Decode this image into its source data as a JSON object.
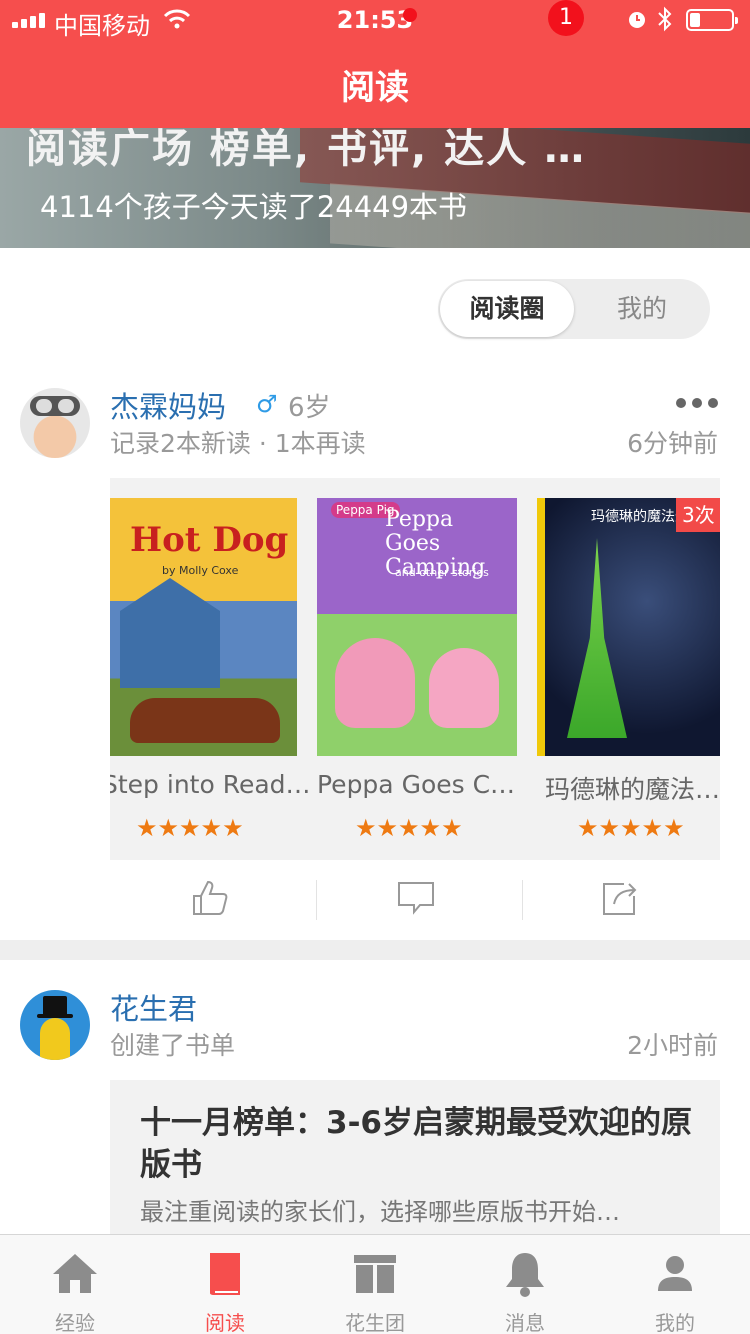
{
  "status_bar": {
    "carrier": "中国移动",
    "time": "21:53"
  },
  "nav": {
    "title": "阅读"
  },
  "banner": {
    "headline": "阅读广场 榜单, 书评, 达人 …",
    "subtitle": "4114个孩子今天读了24449本书"
  },
  "segmented": {
    "active": "阅读圈",
    "inactive": "我的"
  },
  "post1": {
    "user": "杰霖妈妈",
    "gender_symbol": "♂",
    "age": "6岁",
    "summary": "记录2本新读 · 1本再读",
    "time": "6分钟前",
    "books": [
      {
        "title": "Step into Read…",
        "cover_title": "Hot Dog",
        "cover_byline": "by Molly Coxe",
        "stars": "★★★★★",
        "rating": 5
      },
      {
        "title": "Peppa  Goes C…",
        "cover_title": "Peppa Goes Camping",
        "cover_subtitle": "and other stories",
        "cover_logo": "Peppa Pig",
        "stars": "★★★★★",
        "rating": 5
      },
      {
        "title": "玛德琳的魔法…",
        "cover_title": "玛德琳的魔法圣",
        "badge": "3次",
        "stars": "★★★★★",
        "rating": 5
      }
    ]
  },
  "post2": {
    "user": "花生君",
    "summary": "创建了书单",
    "time": "2小时前",
    "booklist_title": "十一月榜单：3-6岁启蒙期最受欢迎的原版书",
    "booklist_desc": "最注重阅读的家长们，选择哪些原版书开始…"
  },
  "tabs": [
    {
      "label": "经验",
      "icon": "home-icon"
    },
    {
      "label": "阅读",
      "icon": "book-icon"
    },
    {
      "label": "花生团",
      "icon": "group-icon"
    },
    {
      "label": "消息",
      "icon": "bell-icon"
    },
    {
      "label": "我的",
      "icon": "person-icon"
    }
  ],
  "message_badge": "1",
  "colors": {
    "brand": "#f64e4d",
    "link": "#2a6fb0",
    "star": "#ee7a12"
  }
}
